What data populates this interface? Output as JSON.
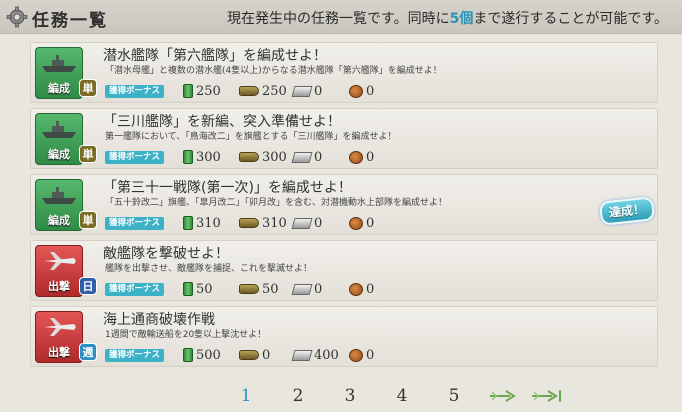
{
  "header": {
    "title": "任務一覧",
    "notice_pre": "現在発生中の任務一覧です。同時に",
    "notice_num": "5個",
    "notice_post": "まで遂行することが可能です。"
  },
  "quests": [
    {
      "category": "編成",
      "category_color": "green",
      "frequency": "単",
      "frequency_type": "once",
      "title": "潜水艦隊「第六艦隊」を編成せよ！",
      "desc": "「潜水母艦」と複数の潜水艦(4隻以上)からなる潜水艦隊「第六艦隊」を編成せよ！",
      "bonus": "獲得ボーナス",
      "rewards": {
        "fuel": "250",
        "ammo": "250",
        "steel": "0",
        "bauxite": "0"
      }
    },
    {
      "category": "編成",
      "category_color": "green",
      "frequency": "単",
      "frequency_type": "once",
      "title": "「三川艦隊」を新編、突入準備せよ！",
      "desc": "第一艦隊において、「鳥海改二」を旗艦とする「三川艦隊」を編成せよ！",
      "bonus": "獲得ボーナス",
      "rewards": {
        "fuel": "300",
        "ammo": "300",
        "steel": "0",
        "bauxite": "0"
      }
    },
    {
      "category": "編成",
      "category_color": "green",
      "frequency": "単",
      "frequency_type": "once",
      "title": "「第三十一戦隊(第一次)」を編成せよ！",
      "desc": "「五十鈴改二」旗艦、「皐月改二」「卯月改」を含む、対潜機動水上部隊を編成せよ！",
      "bonus": "獲得ボーナス",
      "rewards": {
        "fuel": "310",
        "ammo": "310",
        "steel": "0",
        "bauxite": "0"
      },
      "achieved_label": "達成！"
    },
    {
      "category": "出撃",
      "category_color": "red",
      "frequency": "日",
      "frequency_type": "daily",
      "title": "敵艦隊を撃破せよ！",
      "desc": "艦隊を出撃させ、敵艦隊を捕捉、これを撃滅せよ！",
      "bonus": "獲得ボーナス",
      "rewards": {
        "fuel": "50",
        "ammo": "50",
        "steel": "0",
        "bauxite": "0"
      }
    },
    {
      "category": "出撃",
      "category_color": "red",
      "frequency": "週",
      "frequency_type": "weekly",
      "title": "海上通商破壊作戦",
      "desc": "1週間で敵輸送船を20隻以上撃沈せよ！",
      "bonus": "獲得ボーナス",
      "rewards": {
        "fuel": "500",
        "ammo": "0",
        "steel": "400",
        "bauxite": "0"
      }
    }
  ],
  "pager": {
    "pages": [
      "1",
      "2",
      "3",
      "4",
      "5"
    ],
    "current": "1"
  },
  "icons": {
    "header": "gear-icon",
    "next": "next-page-icon",
    "last": "last-page-icon"
  },
  "colors": {
    "accent": "#2a93b8",
    "bonus": "#3db1c6",
    "compose": "#3a9a52",
    "sortie": "#c83535"
  }
}
